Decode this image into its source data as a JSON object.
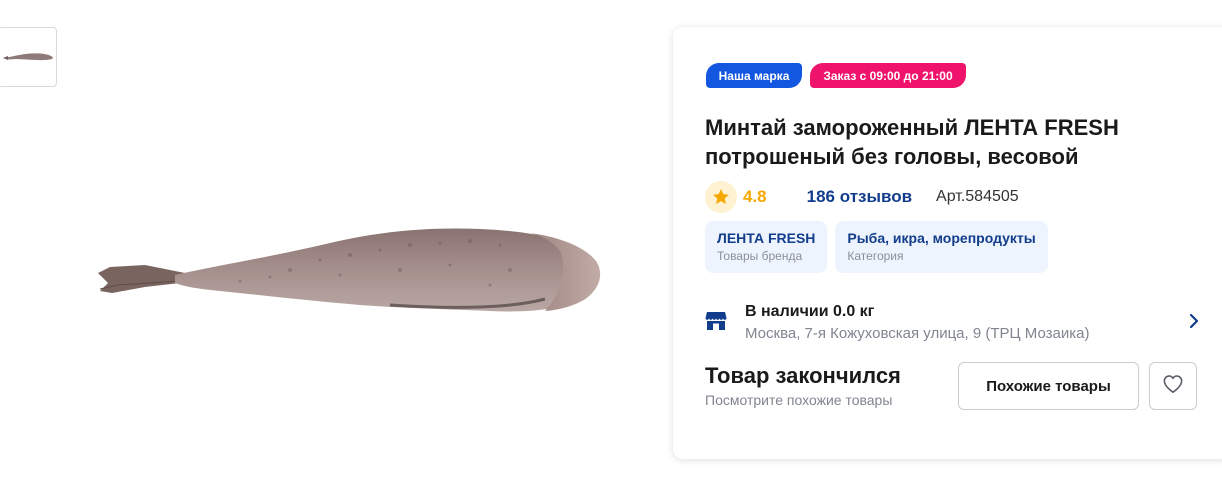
{
  "gallery": {
    "thumbnail_alt": "fish-thumbnail",
    "main_image_alt": "fish-image"
  },
  "badges": {
    "brand": "Наша марка",
    "order_time": "Заказ с 09:00 до 21:00",
    "brand_color": "#1357e0",
    "order_time_color": "#f0136b"
  },
  "product": {
    "title": "Минтай замороженный ЛЕНТА FRESH потрошеный без головы, весовой",
    "rating": "4.8",
    "reviews": "186 отзывов",
    "sku": "Арт.584505"
  },
  "chips": {
    "brand_title": "ЛЕНТА FRESH",
    "brand_sub": "Товары бренда",
    "category_title": "Рыба, икра, морепродукты",
    "category_sub": "Категория"
  },
  "stock": {
    "title": "В наличии 0.0 кг",
    "address": "Москва, 7-я Кожуховская улица, 9 (ТРЦ Мозаика)",
    "icon": "store-icon"
  },
  "availability": {
    "title": "Товар закончился",
    "subtitle": "Посмотрите похожие товары",
    "similar_button": "Похожие товары",
    "favorite_icon": "heart-icon"
  },
  "colors": {
    "accent_blue": "#123d8c",
    "rating_star": "#f5a800"
  }
}
